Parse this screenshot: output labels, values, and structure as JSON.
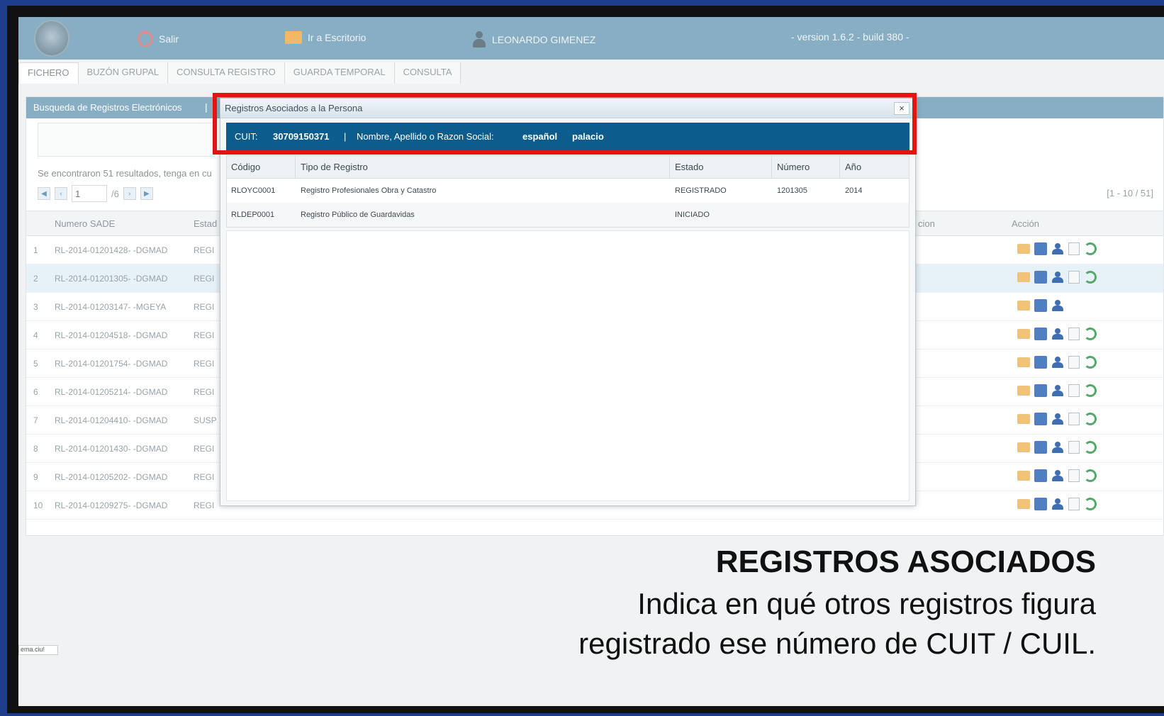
{
  "header": {
    "exit_label": "Salir",
    "desk_label": "Ir a Escritorio",
    "user_name": "LEONARDO GIMENEZ",
    "version": "- version 1.6.2 - build 380 -"
  },
  "tabs": [
    {
      "label": "FICHERO"
    },
    {
      "label": "BUZÓN GRUPAL"
    },
    {
      "label": "CONSULTA REGISTRO"
    },
    {
      "label": "GUARDA TEMPORAL"
    },
    {
      "label": "CONSULTA"
    }
  ],
  "panel": {
    "title": "Busqueda de Registros Electrónicos",
    "separator": "|",
    "result_text": "Se encontraron 51 resultados, tenga en cu",
    "page_value": "1",
    "page_total": "/6",
    "range": "[1 - 10 / 51]",
    "columns": {
      "numero": "Numero SADE",
      "estado": "Estad",
      "cion": "cion",
      "accion": "Acción"
    },
    "rows": [
      {
        "n": "1",
        "numero": "RL-2014-01201428- -DGMAD",
        "estado": "REGI",
        "alt": false,
        "full_actions": true
      },
      {
        "n": "2",
        "numero": "RL-2014-01201305- -DGMAD",
        "estado": "REGI",
        "alt": true,
        "full_actions": true
      },
      {
        "n": "3",
        "numero": "RL-2014-01203147- -MGEYA",
        "estado": "REGI",
        "alt": false,
        "full_actions": false
      },
      {
        "n": "4",
        "numero": "RL-2014-01204518- -DGMAD",
        "estado": "REGI",
        "alt": false,
        "full_actions": true
      },
      {
        "n": "5",
        "numero": "RL-2014-01201754- -DGMAD",
        "estado": "REGI",
        "alt": false,
        "full_actions": true
      },
      {
        "n": "6",
        "numero": "RL-2014-01205214- -DGMAD",
        "estado": "REGI",
        "alt": false,
        "full_actions": true
      },
      {
        "n": "7",
        "numero": "RL-2014-01204410- -DGMAD",
        "estado": "SUSP",
        "alt": false,
        "full_actions": true
      },
      {
        "n": "8",
        "numero": "RL-2014-01201430- -DGMAD",
        "estado": "REGI",
        "alt": false,
        "full_actions": true
      },
      {
        "n": "9",
        "numero": "RL-2014-01205202- -DGMAD",
        "estado": "REGI",
        "alt": false,
        "full_actions": true
      },
      {
        "n": "10",
        "numero": "RL-2014-01209275- -DGMAD",
        "estado": "REGI",
        "alt": false,
        "full_actions": true
      }
    ]
  },
  "modal": {
    "title": "Registros Asociados a la Persona",
    "close": "×",
    "cuit_label": "CUIT:",
    "cuit_value": "30709150371",
    "sep": "|",
    "name_label": "Nombre, Apellido o Razon Social:",
    "name_value_1": "español",
    "name_value_2": "palacio",
    "columns": {
      "codigo": "Código",
      "tipo": "Tipo de Registro",
      "estado": "Estado",
      "numero": "Número",
      "anio": "Año"
    },
    "rows": [
      {
        "codigo": "RLOYC0001",
        "tipo": "Registro Profesionales Obra y Catastro",
        "estado": "REGISTRADO",
        "numero": "1201305",
        "anio": "2014"
      },
      {
        "codigo": "RLDEP0001",
        "tipo": "Registro Público de Guardavidas",
        "estado": "INICIADO",
        "numero": "",
        "anio": ""
      }
    ]
  },
  "caption": {
    "title": "REGISTROS ASOCIADOS",
    "line1": "Indica en qué otros registros figura",
    "line2": "registrado ese número de CUIT / CUIL."
  },
  "mini_tab": "ema.ciu!",
  "colors": {
    "frame": "#1d3e8c",
    "header": "#88aec4",
    "cuit_bar": "#0c5d8e",
    "highlight": "#e41414"
  }
}
